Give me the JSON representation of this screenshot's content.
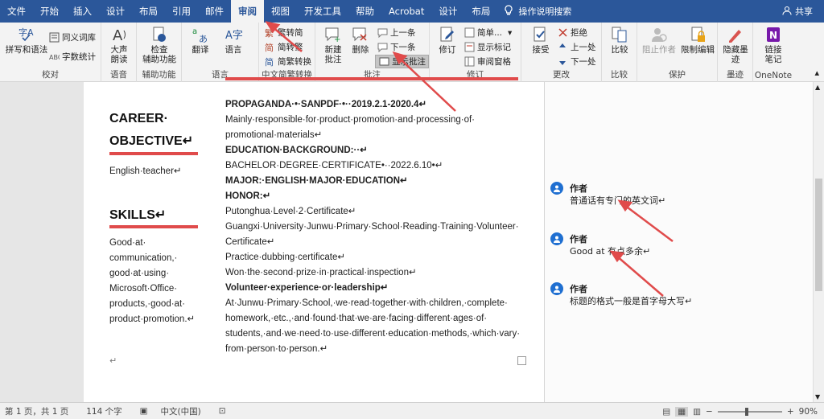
{
  "menubar": {
    "tabs": [
      "文件",
      "开始",
      "插入",
      "设计",
      "布局",
      "引用",
      "邮件",
      "审阅",
      "视图",
      "开发工具",
      "帮助",
      "Acrobat",
      "设计",
      "布局"
    ],
    "active_index": 7,
    "search_label": "操作说明搜索",
    "share_label": "共享"
  },
  "ribbon": {
    "proofing": {
      "label": "校对",
      "spelling": "拼写和语法",
      "thesaurus": "同义词库",
      "wordcount": "字数统计"
    },
    "speech": {
      "label": "语音",
      "readaloud": "大声\n朗读"
    },
    "accessibility": {
      "label": "辅助功能",
      "check": "检查\n辅助功能"
    },
    "language": {
      "label": "语言",
      "translate": "翻译",
      "language": "语言"
    },
    "chinese": {
      "label": "中文简繁转换",
      "to_simplified": "繁转简",
      "to_traditional": "简转繁",
      "convert": "简繁转换"
    },
    "comments": {
      "label": "批注",
      "new": "新建\n批注",
      "delete": "删除",
      "prev": "上一条",
      "next": "下一条",
      "show": "显示批注"
    },
    "tracking": {
      "label": "修订",
      "track": "修订",
      "display": "简单...",
      "show_markup": "显示标记",
      "pane": "审阅窗格"
    },
    "changes": {
      "label": "更改",
      "accept": "接受",
      "reject": "拒绝",
      "prev": "上一处",
      "next": "下一处"
    },
    "compare": {
      "label": "比较",
      "compare": "比较"
    },
    "protect": {
      "label": "保护",
      "block": "阻止作者",
      "restrict": "限制编辑"
    },
    "ink": {
      "label": "墨迹",
      "hide": "隐藏墨\n迹"
    },
    "onenote": {
      "label": "OneNote",
      "link": "链接\n笔记"
    }
  },
  "document": {
    "left": {
      "career_1": "CAREER·",
      "career_2": "OBJECTIVE↵",
      "career_text": "English·teacher↵",
      "skills": "SKILLS↵",
      "skills_lines": [
        "Good·at·",
        "communication,·",
        "good·at·using·",
        "Microsoft·Office·",
        "products,·good·at·",
        "product·promotion.↵"
      ]
    },
    "body": [
      {
        "t": "PROPAGANDA·•·SANPDF·•··2019.2.1-2020.4↵",
        "b": true
      },
      {
        "t": "Mainly·responsible·for·product·promotion·and·processing·of·",
        "b": false
      },
      {
        "t": "promotional·materials↵",
        "b": false
      },
      {
        "t": "EDUCATION·BACKGROUND:··↵",
        "b": true
      },
      {
        "t": "BACHELOR·DEGREE·CERTIFICATE•··2022.6.10•↵",
        "b": false
      },
      {
        "t": "MAJOR:·ENGLISH·MAJOR·EDUCATION↵",
        "b": true
      },
      {
        "t": "HONOR:↵",
        "b": true
      },
      {
        "t": "Putonghua·Level·2·Certificate↵",
        "b": false
      },
      {
        "t": "Guangxi·University·Junwu·Primary·School·Reading·Training·Volunteer·",
        "b": false
      },
      {
        "t": "Certificate↵",
        "b": false
      },
      {
        "t": "Practice·dubbing·certificate↵",
        "b": false
      },
      {
        "t": "Won·the·second·prize·in·practical·inspection↵",
        "b": false
      },
      {
        "t": "Volunteer·experience·or·leadership↵",
        "b": true
      },
      {
        "t": "At·Junwu·Primary·School,·we·read·together·with·children,·complete·",
        "b": false
      },
      {
        "t": "homework,·etc.,·and·found·that·we·are·facing·different·ages·of·",
        "b": false
      },
      {
        "t": "students,·and·we·need·to·use·different·education·methods,·which·vary·",
        "b": false
      },
      {
        "t": "from·person·to·person.↵",
        "b": false
      }
    ],
    "end_mark": "↵"
  },
  "comments": [
    {
      "author": "作者",
      "text": "普通话有专门的英文词↵"
    },
    {
      "author": "作者",
      "text": "Good at 有点多余↵"
    },
    {
      "author": "作者",
      "text": "标题的格式一般是首字母大写↵"
    }
  ],
  "statusbar": {
    "page": "第 1 页，共 1 页",
    "words": "114 个字",
    "lang": "中文(中国)",
    "zoom": "90%"
  },
  "colors": {
    "accent": "#2b579a",
    "highlight_red": "#e04b4b",
    "avatar": "#1f6fd1"
  }
}
